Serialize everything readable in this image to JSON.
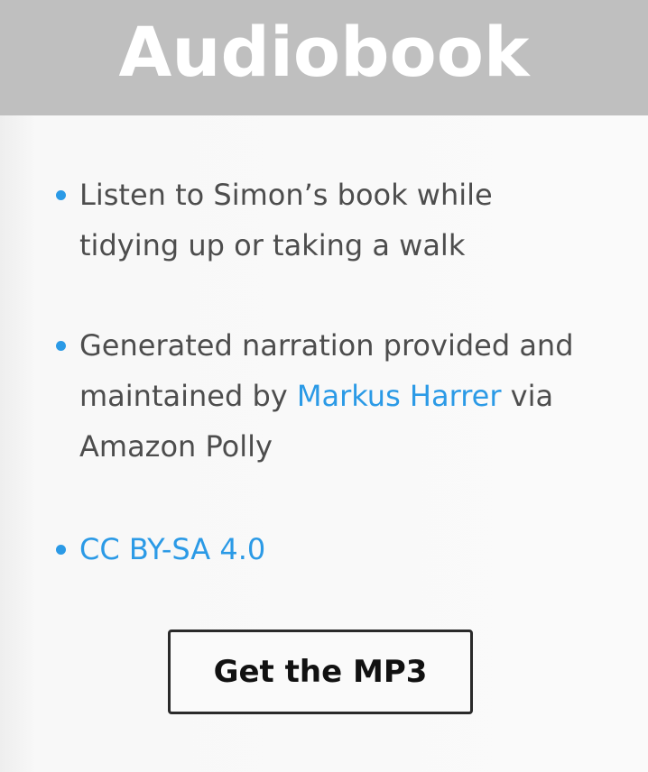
{
  "header": {
    "title": "Audiobook"
  },
  "features": [
    {
      "text": "Listen to Simon’s book while tidying up or taking a walk"
    },
    {
      "text_before": "Generated narration provided and maintained by ",
      "link_label": "Markus Harrer",
      "text_after": " via Amazon Polly"
    },
    {
      "link_label": "CC BY-SA 4.0"
    }
  ],
  "download": {
    "button_label": "Get the MP3"
  },
  "colors": {
    "header_bg": "#bfbfbf",
    "accent": "#2b9ae6",
    "body_text": "#4d4d4d"
  },
  "icons": {
    "bullet": "bullet-dot-icon"
  }
}
